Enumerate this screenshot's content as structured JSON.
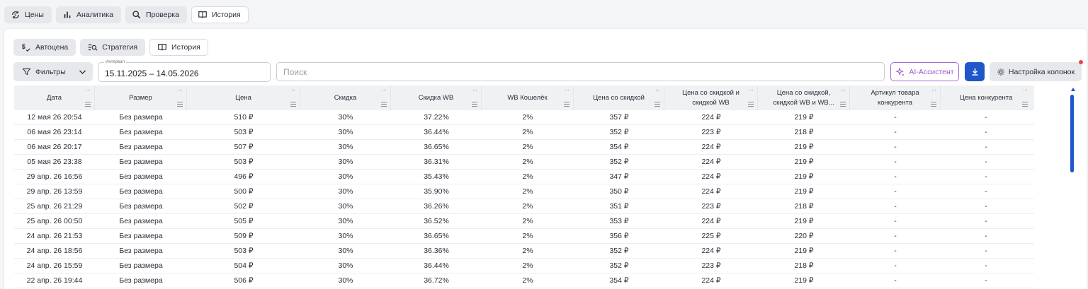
{
  "top_tabs": [
    {
      "label": "Цены",
      "icon": "price-cycle-icon",
      "active": false
    },
    {
      "label": "Аналитика",
      "icon": "bar-chart-icon",
      "active": false
    },
    {
      "label": "Проверка",
      "icon": "search-icon",
      "active": false
    },
    {
      "label": "История",
      "icon": "book-icon",
      "active": true
    }
  ],
  "sub_tabs": [
    {
      "label": "Автоцена",
      "icon": "auto-price-icon",
      "active": false
    },
    {
      "label": "Стратегия",
      "icon": "strategy-icon",
      "active": false
    },
    {
      "label": "История",
      "icon": "book-icon",
      "active": true
    }
  ],
  "toolbar": {
    "filters_label": "Фильтры",
    "interval_caption": "Интервал",
    "interval_value": "15.11.2025 – 14.05.2026",
    "search_placeholder": "Поиск",
    "ai_label": "AI-Ассистент",
    "columns_label": "Настройка колонок"
  },
  "colors": {
    "accent": "#1f56c9",
    "ai": "#9b59c9",
    "notify": "#e5484d"
  },
  "table": {
    "columns": [
      [
        "Дата"
      ],
      [
        "Размер"
      ],
      [
        "Цена"
      ],
      [
        "Скидка"
      ],
      [
        "Скидка WB"
      ],
      [
        "WB Кошелёк"
      ],
      [
        "Цена со скидкой"
      ],
      [
        "Цена со скидкой и",
        "скидкой WB"
      ],
      [
        "Цена со скидкой,",
        "скидкой WB и WB..."
      ],
      [
        "Артикул товара",
        "конкурента"
      ],
      [
        "Цена конкурента"
      ]
    ],
    "rows": [
      [
        "12 мая 26 20:54",
        "Без размера",
        "510 ₽",
        "30%",
        "37.22%",
        "2%",
        "357 ₽",
        "224 ₽",
        "219 ₽",
        "-",
        "-"
      ],
      [
        "06 мая 26 23:14",
        "Без размера",
        "503 ₽",
        "30%",
        "36.44%",
        "2%",
        "352 ₽",
        "223 ₽",
        "218 ₽",
        "-",
        "-"
      ],
      [
        "06 мая 26 20:17",
        "Без размера",
        "507 ₽",
        "30%",
        "36.65%",
        "2%",
        "354 ₽",
        "224 ₽",
        "219 ₽",
        "-",
        "-"
      ],
      [
        "05 мая 26 23:38",
        "Без размера",
        "503 ₽",
        "30%",
        "36.31%",
        "2%",
        "352 ₽",
        "224 ₽",
        "219 ₽",
        "-",
        "-"
      ],
      [
        "29 апр. 26 16:56",
        "Без размера",
        "496 ₽",
        "30%",
        "35.43%",
        "2%",
        "347 ₽",
        "224 ₽",
        "219 ₽",
        "-",
        "-"
      ],
      [
        "29 апр. 26 13:59",
        "Без размера",
        "500 ₽",
        "30%",
        "35.90%",
        "2%",
        "350 ₽",
        "224 ₽",
        "219 ₽",
        "-",
        "-"
      ],
      [
        "25 апр. 26 21:29",
        "Без размера",
        "502 ₽",
        "30%",
        "36.26%",
        "2%",
        "351 ₽",
        "223 ₽",
        "218 ₽",
        "-",
        "-"
      ],
      [
        "25 апр. 26 00:50",
        "Без размера",
        "505 ₽",
        "30%",
        "36.52%",
        "2%",
        "353 ₽",
        "224 ₽",
        "219 ₽",
        "-",
        "-"
      ],
      [
        "24 апр. 26 21:53",
        "Без размера",
        "509 ₽",
        "30%",
        "36.65%",
        "2%",
        "356 ₽",
        "225 ₽",
        "220 ₽",
        "-",
        "-"
      ],
      [
        "24 апр. 26 18:56",
        "Без размера",
        "503 ₽",
        "30%",
        "36.36%",
        "2%",
        "352 ₽",
        "224 ₽",
        "219 ₽",
        "-",
        "-"
      ],
      [
        "24 апр. 26 15:59",
        "Без размера",
        "504 ₽",
        "30%",
        "36.44%",
        "2%",
        "352 ₽",
        "223 ₽",
        "218 ₽",
        "-",
        "-"
      ],
      [
        "22 апр. 26 19:44",
        "Без размера",
        "506 ₽",
        "30%",
        "36.72%",
        "2%",
        "354 ₽",
        "224 ₽",
        "219 ₽",
        "-",
        "-"
      ]
    ]
  }
}
